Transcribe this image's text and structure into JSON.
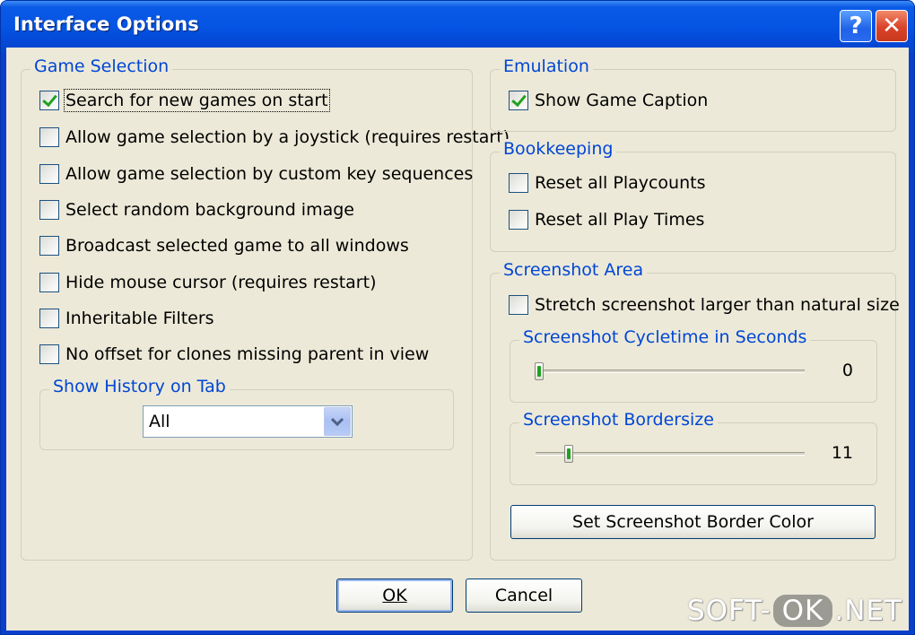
{
  "window": {
    "title": "Interface Options"
  },
  "titlebar": {
    "help_label": "?",
    "close_label": "✕"
  },
  "game_selection": {
    "label": "Game Selection",
    "options": [
      {
        "text": "Search for new games on start",
        "checked": true
      },
      {
        "text": "Allow game selection by a joystick (requires restart)",
        "checked": false
      },
      {
        "text": "Allow game selection by custom key sequences",
        "checked": false
      },
      {
        "text": "Select random background image",
        "checked": false
      },
      {
        "text": "Broadcast selected game to all windows",
        "checked": false
      },
      {
        "text": "Hide mouse cursor (requires restart)",
        "checked": false
      },
      {
        "text": "Inheritable Filters",
        "checked": false
      },
      {
        "text": "No offset for clones missing parent in view",
        "checked": false
      }
    ],
    "history": {
      "label": "Show History on Tab",
      "selected": "All"
    }
  },
  "emulation": {
    "label": "Emulation",
    "options": [
      {
        "text": "Show Game Caption",
        "checked": true
      }
    ]
  },
  "bookkeeping": {
    "label": "Bookkeeping",
    "options": [
      {
        "text": "Reset all Playcounts",
        "checked": false
      },
      {
        "text": "Reset all Play Times",
        "checked": false
      }
    ]
  },
  "screenshot_area": {
    "label": "Screenshot Area",
    "options": [
      {
        "text": "Stretch screenshot larger than natural size",
        "checked": false
      }
    ],
    "cycletime": {
      "label": "Screenshot Cycletime in Seconds",
      "value": "0",
      "fraction": 0.0
    },
    "bordersize": {
      "label": "Screenshot Bordersize",
      "value": "11",
      "fraction": 0.11
    },
    "border_color_button": "Set Screenshot Border Color"
  },
  "footer": {
    "ok_label": "OK",
    "cancel_label": "Cancel"
  },
  "watermark": {
    "part1": "SOFT-",
    "part2": "OK",
    "part3": ".NET"
  }
}
